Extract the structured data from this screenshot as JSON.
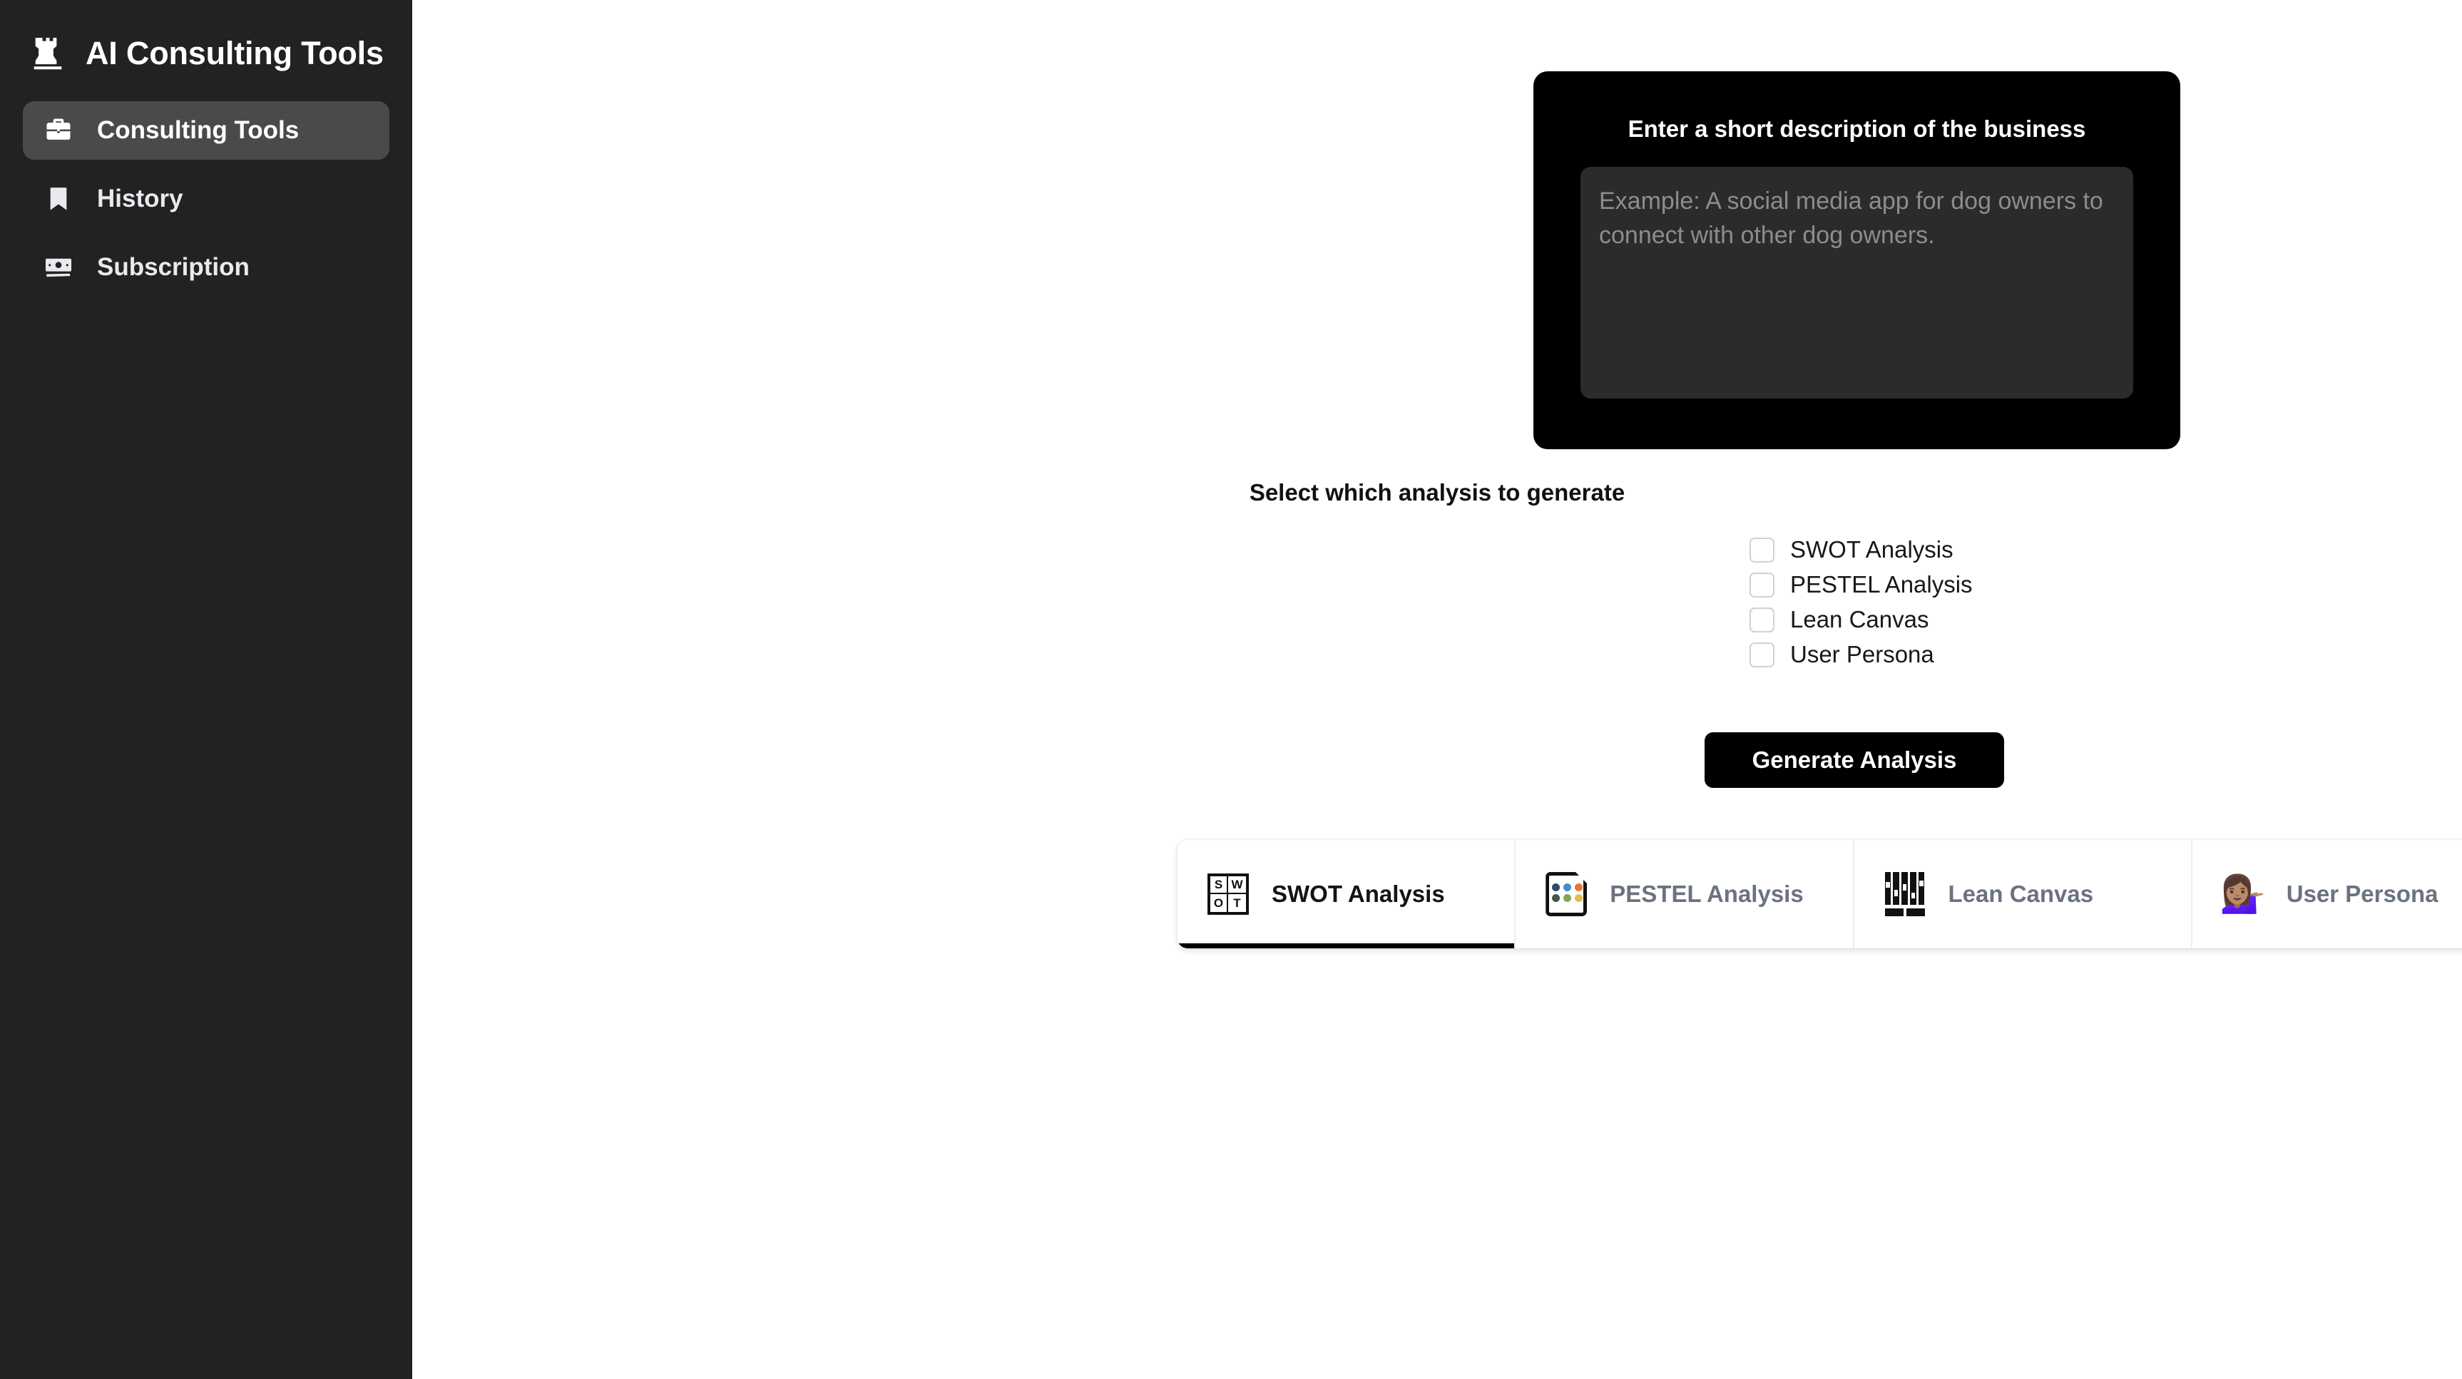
{
  "sidebar": {
    "brand": {
      "title": "AI Consulting Tools",
      "logo_icon": "chess-rook-icon"
    },
    "items": [
      {
        "label": "Consulting Tools",
        "icon": "briefcase-icon",
        "active": true
      },
      {
        "label": "History",
        "icon": "bookmark-icon",
        "active": false
      },
      {
        "label": "Subscription",
        "icon": "banknote-icon",
        "active": false
      }
    ]
  },
  "description_card": {
    "title": "Enter a short description of the business",
    "textarea_placeholder": "Example: A social media app for dog owners to connect with other dog owners.",
    "textarea_value": "",
    "background_color": "#000000",
    "field_color": "#2b2b2b"
  },
  "analysis_selection": {
    "heading": "Select which analysis to generate",
    "options": [
      {
        "label": "SWOT Analysis",
        "checked": false
      },
      {
        "label": "PESTEL Analysis",
        "checked": false
      },
      {
        "label": "Lean Canvas",
        "checked": false
      },
      {
        "label": "User Persona",
        "checked": false
      }
    ]
  },
  "actions": {
    "generate_label": "Generate Analysis"
  },
  "tabs": [
    {
      "label": "SWOT Analysis",
      "icon": "swot-grid-icon",
      "active": true
    },
    {
      "label": "PESTEL Analysis",
      "icon": "document-dots-icon",
      "active": false
    },
    {
      "label": "Lean Canvas",
      "icon": "abacus-icon",
      "active": false
    },
    {
      "label": "User Persona",
      "icon": "person-tipping-hand-emoji",
      "active": false
    }
  ],
  "swot_icon_letters": [
    "S",
    "W",
    "O",
    "T"
  ],
  "pestel_icon_dot_colors": [
    "#2f4b6e",
    "#4a8cc7",
    "#e8762c",
    "#4b5545",
    "#8aa24f",
    "#e8bd46"
  ],
  "persona_emoji": "💁🏽‍♀️",
  "colors": {
    "sidebar_bg": "#222222",
    "sidebar_active": "#4a4a4a",
    "main_bg": "#ffffff",
    "accent_black": "#000000",
    "muted_text": "#6b7280",
    "checkbox_border": "#cfd2d6"
  }
}
